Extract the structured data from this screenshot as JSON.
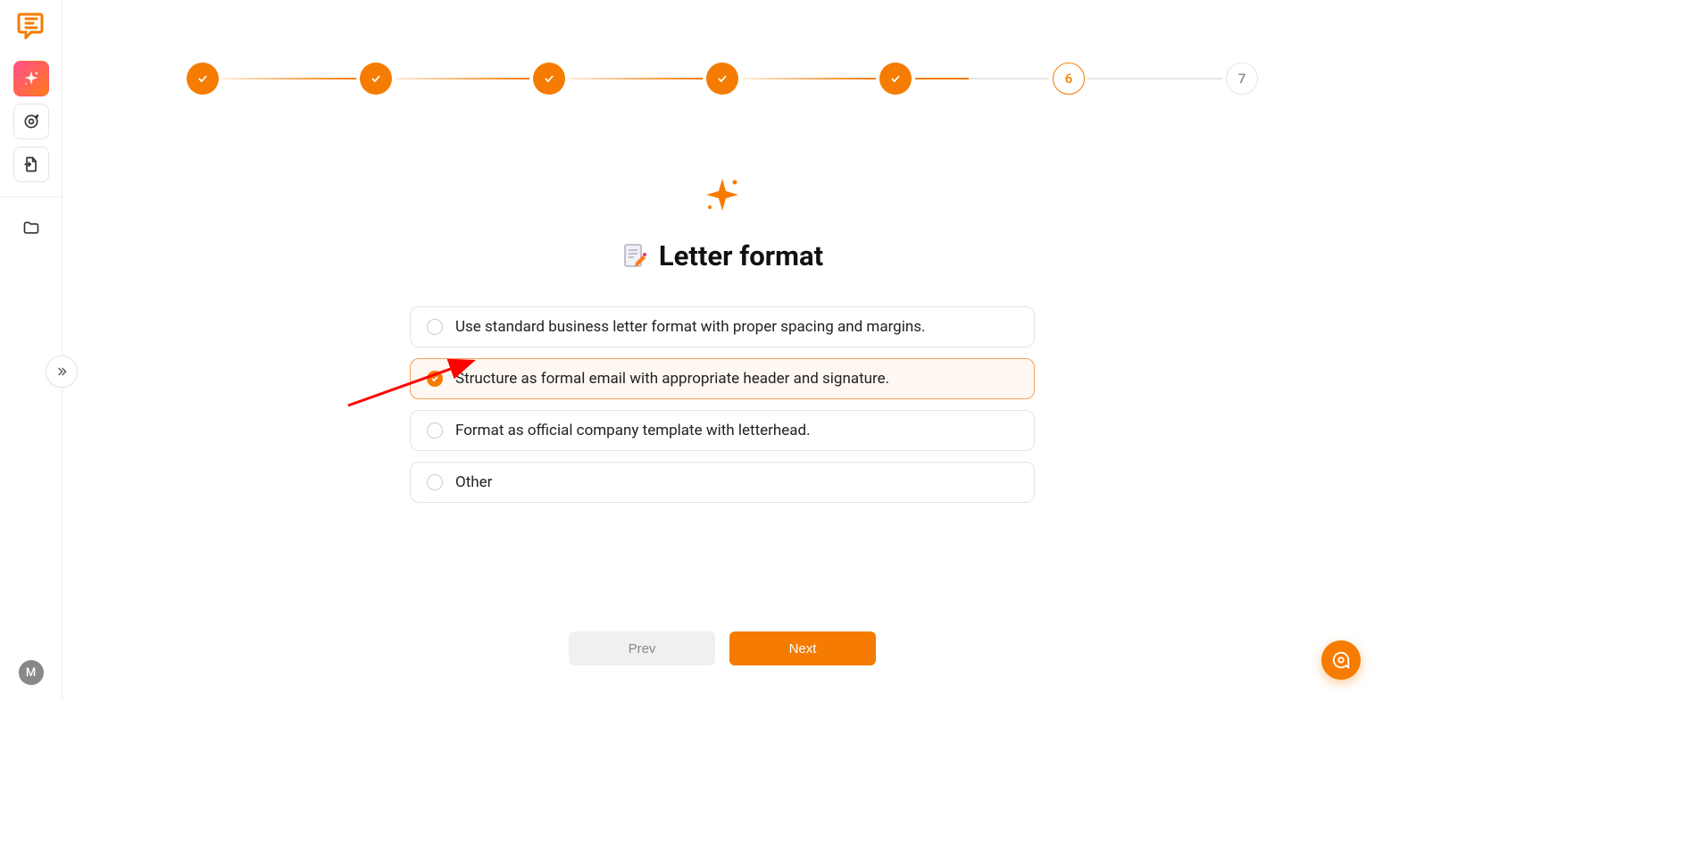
{
  "sidebar": {
    "avatar_initial": "M"
  },
  "stepper": {
    "steps": [
      {
        "state": "done"
      },
      {
        "state": "done"
      },
      {
        "state": "done"
      },
      {
        "state": "done"
      },
      {
        "state": "done"
      },
      {
        "state": "current",
        "label": "6"
      },
      {
        "state": "pending",
        "label": "7"
      }
    ]
  },
  "page": {
    "title": "Letter format"
  },
  "options": [
    {
      "text": "Use standard business letter format with proper spacing and margins.",
      "selected": false
    },
    {
      "text": "Structure as formal email with appropriate header and signature.",
      "selected": true
    },
    {
      "text": "Format as official company template with letterhead.",
      "selected": false
    },
    {
      "text": "Other",
      "selected": false
    }
  ],
  "footer": {
    "prev": "Prev",
    "next": "Next"
  },
  "colors": {
    "accent": "#f57c00"
  }
}
